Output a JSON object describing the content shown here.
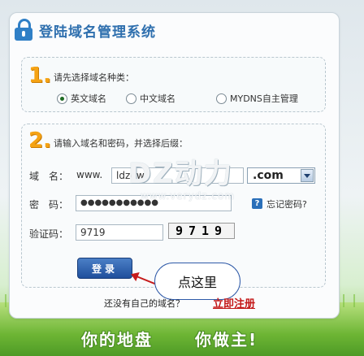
{
  "header": {
    "title": "登陆域名管理系统"
  },
  "step1": {
    "number": "1.",
    "prompt": "请先选择域名种类：",
    "options": [
      {
        "label": "英文域名",
        "selected": true
      },
      {
        "label": "中文域名",
        "selected": false
      },
      {
        "label": "MYDNS自主管理",
        "selected": false
      }
    ]
  },
  "step2": {
    "number": "2.",
    "prompt": "请输入域名和密码，并选择后缀：",
    "domain_label": "域　名：",
    "domain_prefix": "www.",
    "domain_value": "ldzdw",
    "suffix_selected": ".com",
    "password_label": "密　码：",
    "password_value": "●●●●●●●●●●●",
    "help_icon": "?",
    "forgot_label": "忘记密码?",
    "captcha_label": "验证码：",
    "captcha_value": "9719",
    "captcha_image_text": "9719"
  },
  "actions": {
    "login_label": "登录",
    "hint_bubble": "点这里",
    "register_prompt": "还没有自己的域名？",
    "register_link": "立即注册"
  },
  "watermark": {
    "logo": "DZ动力",
    "site": "www.verydz.com"
  },
  "footer": {
    "slogan_left": "你的地盘",
    "slogan_right": "你做主!"
  },
  "colors": {
    "accent": "#2e6fae",
    "step_number": "#f5a314",
    "link_red": "#c41818",
    "grass": "#6db534"
  }
}
